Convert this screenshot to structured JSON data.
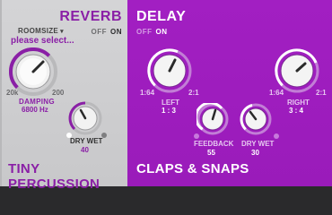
{
  "reverb": {
    "title": "REVERB",
    "off_label": "OFF",
    "on_label": "ON",
    "roomsize_label": "ROOMSIZE",
    "roomsize_value": "please select...",
    "damping": {
      "min": "20k",
      "max": "200",
      "label": "DAMPING",
      "value": "6800 Hz"
    },
    "drywet": {
      "label": "DRY WET",
      "value": "40"
    },
    "bottom_title": "TINY PERCUSSION"
  },
  "delay": {
    "title": "DELAY",
    "off_label": "OFF",
    "on_label": "ON",
    "left": {
      "min": "1:64",
      "max": "2:1",
      "label": "LEFT",
      "value": "1 : 3"
    },
    "right": {
      "min": "1:64",
      "max": "2:1",
      "label": "RIGHT",
      "value": "3 : 4"
    },
    "feedback": {
      "label": "FEEDBACK",
      "value": "55"
    },
    "drywet": {
      "label": "DRY WET",
      "value": "30"
    },
    "bottom_title": "CLAPS & SNAPS"
  },
  "colors": {
    "accent": "#8a1fa6",
    "panel_right": "#a21fc2",
    "panel_left": "#d0d0d2"
  },
  "icons": [
    "dropdown-caret-icon"
  ]
}
